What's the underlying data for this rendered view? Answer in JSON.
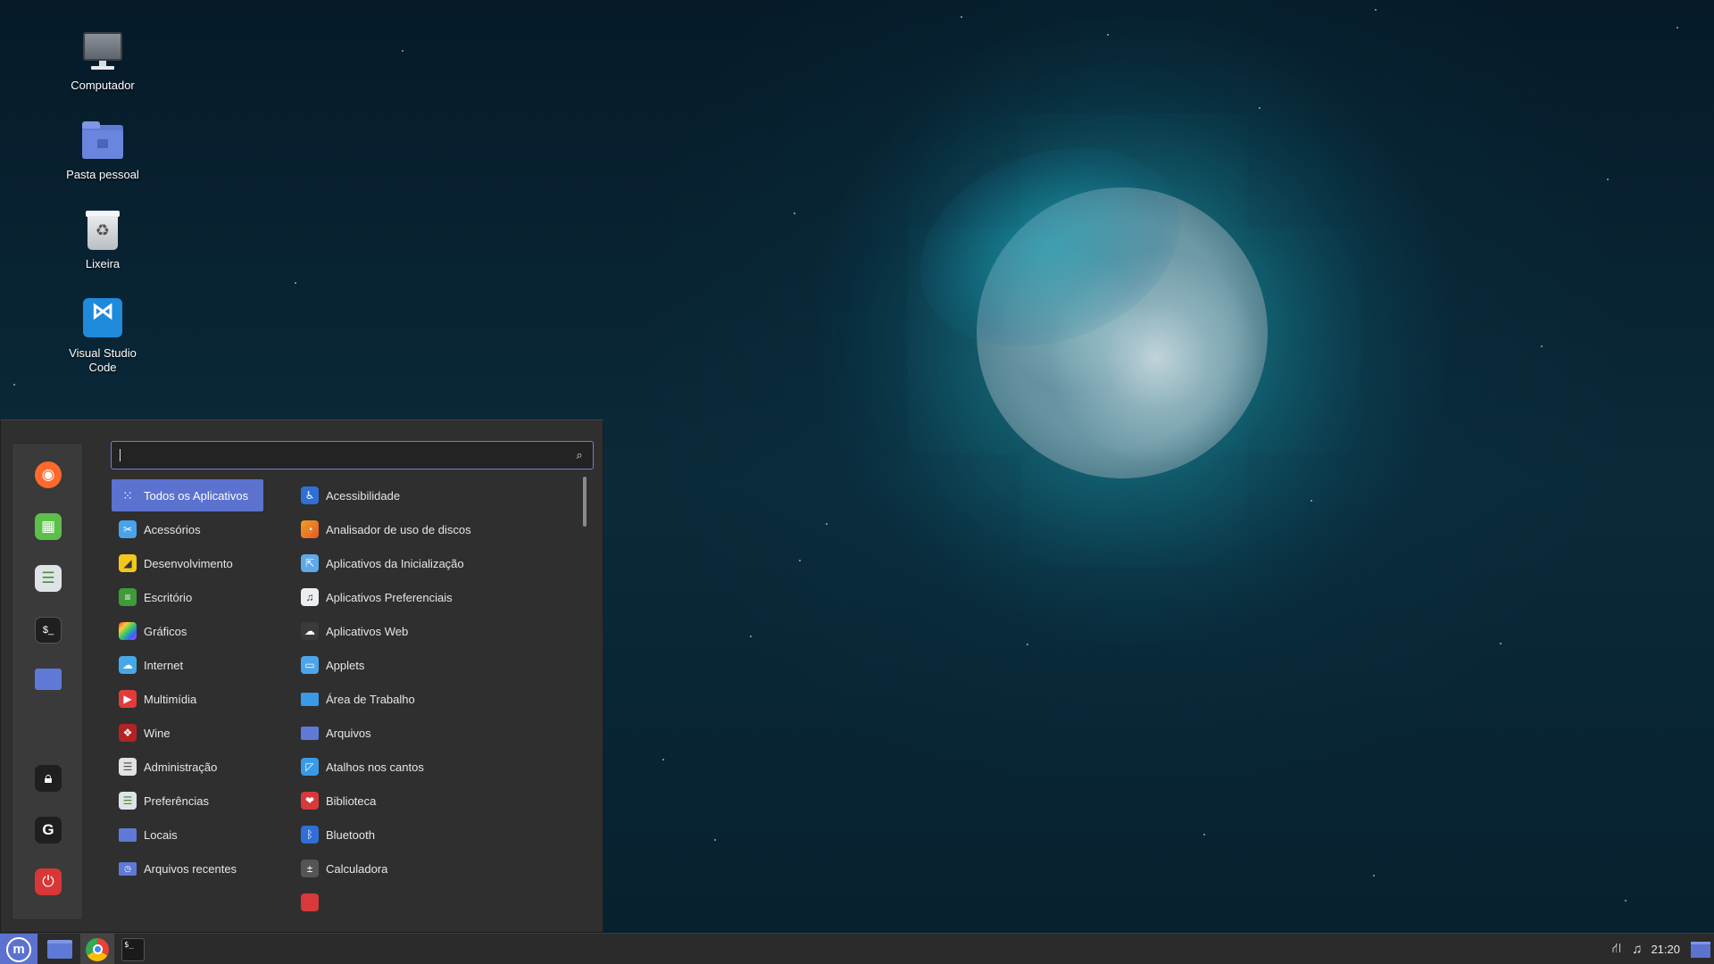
{
  "desktop": {
    "icons": [
      {
        "label": "Computador",
        "icon": "computer-icon"
      },
      {
        "label": "Pasta pessoal",
        "icon": "home-folder-icon"
      },
      {
        "label": "Lixeira",
        "icon": "trash-icon"
      },
      {
        "label": "Visual Studio Code",
        "icon": "vscode-icon"
      }
    ]
  },
  "menu": {
    "search": {
      "value": "",
      "placeholder": ""
    },
    "favorites": [
      {
        "name": "firefox",
        "icon": "firefox-icon",
        "color": "#ff6a2b"
      },
      {
        "name": "calc",
        "icon": "spreadsheet-icon",
        "color": "#5bbf4a"
      },
      {
        "name": "settings",
        "icon": "settings-toggle-icon",
        "color": "#dfe3e6"
      },
      {
        "name": "terminal",
        "icon": "terminal-icon",
        "color": "#1f1f1f"
      },
      {
        "name": "files",
        "icon": "folder-icon",
        "color": "#5f7ad6"
      },
      {
        "name": "lock",
        "icon": "lock-icon",
        "color": "#1f1f1f"
      },
      {
        "name": "logout",
        "icon": "logout-icon",
        "color": "#1f1f1f"
      },
      {
        "name": "shutdown",
        "icon": "power-icon",
        "color": "#d93636"
      }
    ],
    "categories": [
      {
        "label": "Todos os Aplicativos",
        "icon": "grid-icon",
        "active": true
      },
      {
        "label": "Acessórios",
        "icon": "accessories-icon"
      },
      {
        "label": "Desenvolvimento",
        "icon": "development-icon"
      },
      {
        "label": "Escritório",
        "icon": "office-icon"
      },
      {
        "label": "Gráficos",
        "icon": "graphics-icon"
      },
      {
        "label": "Internet",
        "icon": "internet-icon"
      },
      {
        "label": "Multimídia",
        "icon": "multimedia-icon"
      },
      {
        "label": "Wine",
        "icon": "wine-icon"
      },
      {
        "label": "Administração",
        "icon": "administration-icon"
      },
      {
        "label": "Preferências",
        "icon": "preferences-icon"
      },
      {
        "label": "Locais",
        "icon": "places-icon"
      },
      {
        "label": "Arquivos recentes",
        "icon": "recent-files-icon"
      }
    ],
    "apps": [
      {
        "label": "Acessibilidade",
        "icon": "accessibility-icon"
      },
      {
        "label": "Analisador de uso de discos",
        "icon": "disk-usage-icon"
      },
      {
        "label": "Aplicativos da Inicialização",
        "icon": "startup-apps-icon"
      },
      {
        "label": "Aplicativos Preferenciais",
        "icon": "preferred-apps-icon"
      },
      {
        "label": "Aplicativos Web",
        "icon": "web-apps-icon"
      },
      {
        "label": "Applets",
        "icon": "applets-icon"
      },
      {
        "label": "Área de Trabalho",
        "icon": "desktop-icon"
      },
      {
        "label": "Arquivos",
        "icon": "files-icon"
      },
      {
        "label": "Atalhos nos cantos",
        "icon": "hot-corners-icon"
      },
      {
        "label": "Biblioteca",
        "icon": "library-icon"
      },
      {
        "label": "Bluetooth",
        "icon": "bluetooth-icon"
      },
      {
        "label": "Calculadora",
        "icon": "calculator-icon"
      }
    ]
  },
  "taskbar": {
    "clock": "21:20",
    "launchers": [
      {
        "name": "menu",
        "icon": "mint-menu-icon"
      },
      {
        "name": "files",
        "icon": "folder-icon"
      },
      {
        "name": "chrome",
        "icon": "chrome-icon"
      },
      {
        "name": "terminal",
        "icon": "terminal-icon"
      }
    ],
    "tray": [
      {
        "name": "network",
        "icon": "network-icon"
      },
      {
        "name": "sound",
        "icon": "music-note-icon"
      },
      {
        "name": "workspace",
        "icon": "workspace-switcher-icon"
      }
    ]
  },
  "colors": {
    "accent": "#5b72cf",
    "menu_bg": "#2f2f2f",
    "panel_bg": "#2b2b2b"
  }
}
